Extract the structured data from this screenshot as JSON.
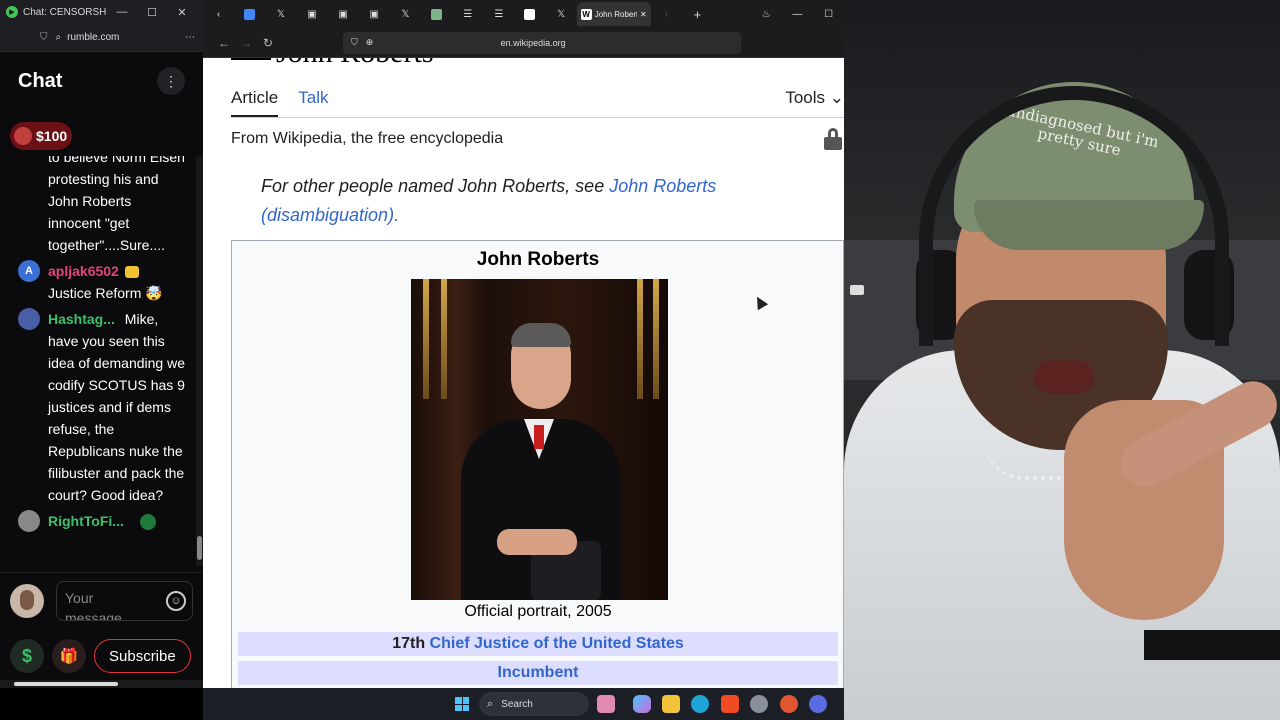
{
  "chat_window": {
    "title": "Chat: CENSORSHIP",
    "url": "rumble.com",
    "header": "Chat",
    "rant_amount": "$100",
    "messages": [
      {
        "user": "",
        "text": "to believe Norm Eisen protesting his and John Roberts innocent \"get together\"....Sure....",
        "user_color": "#ffffff",
        "avatar_color": "#0b0b0d"
      },
      {
        "user": "apljak6502",
        "text": "Justice Reform 🤯",
        "user_color": "#e0457b",
        "avatar_letter": "A",
        "avatar_color": "#3b6fd4"
      },
      {
        "user": "Hashtag...",
        "text": "Mike, have you seen this idea of demanding we codify SCOTUS has 9 justices and if dems refuse, the Republicans nuke the filibuster and pack the court? Good idea?",
        "user_color": "#3cc06a",
        "avatar_color": "#4a5ea8"
      },
      {
        "user": "RightToFi...",
        "text": "",
        "user_color": "#3cc06a",
        "avatar_color": "#888888"
      }
    ],
    "input_placeholder": "Your message...",
    "subscribe_label": "Subscribe",
    "dollar_label": "$",
    "gift_label": "🎁"
  },
  "browser": {
    "active_tab_title": "John Roberts",
    "url": "en.wikipedia.org",
    "tab_icons": [
      "back-icon",
      "docs-icon",
      "x-icon",
      "youtube-icon",
      "youtube-icon",
      "youtube-icon",
      "x-icon",
      "image-icon",
      "list-icon",
      "list-icon",
      "wikipedia-icon",
      "x-icon"
    ]
  },
  "wiki": {
    "title": "John Roberts",
    "tabs": [
      "Article",
      "Talk"
    ],
    "tools_label": "Tools",
    "from_line": "From Wikipedia, the free encyclopedia",
    "hatnote_prefix": "For other people named John Roberts, see ",
    "hatnote_link": "John Roberts (disambiguation)",
    "hatnote_suffix": ".",
    "infobox": {
      "name": "John Roberts",
      "caption": "Official portrait, 2005",
      "office_ordinal": "17th",
      "office_link": "Chief Justice of the United States",
      "status": "Incumbent"
    }
  },
  "webcam": {
    "cap_text": "undiagnosed but i'm pretty sure"
  },
  "taskbar": {
    "search_label": "Search"
  },
  "colors": {
    "wiki_link": "#3366cc",
    "infobox_header_bg": "#ddddff",
    "rumble_green": "#3cc06a",
    "subscribe_red": "#e2343c"
  }
}
